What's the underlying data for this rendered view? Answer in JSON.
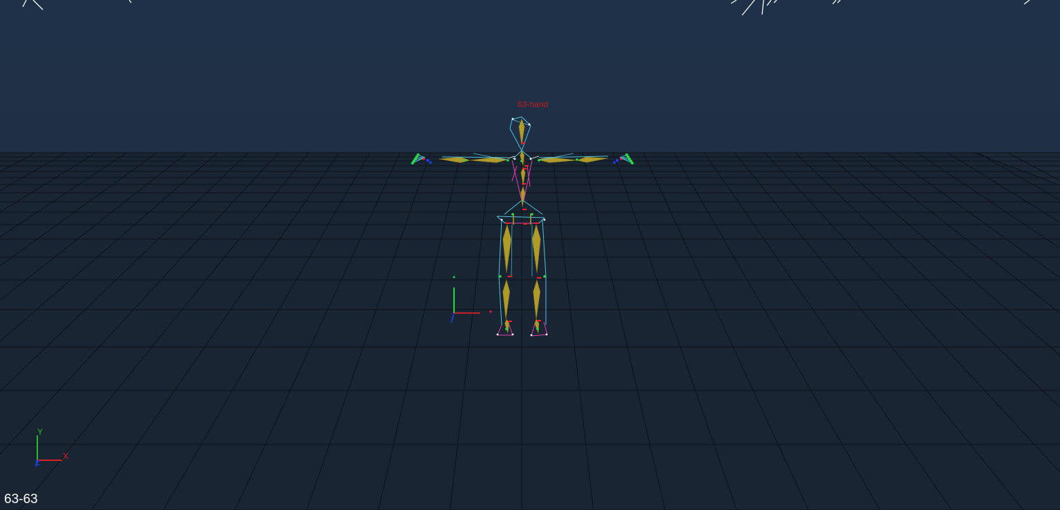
{
  "viewport": {
    "character_label": "63-hand",
    "frame_readout": "63-63"
  },
  "axis_gizmo": {
    "x_label": "X",
    "y_label": "Y",
    "z_label": "Z",
    "x_color": "#e02020",
    "y_color": "#20c020",
    "z_color": "#2040ff"
  },
  "colors": {
    "background": "#1f3148",
    "floor": "#1a2533",
    "grid_line": "#0c1218",
    "bone": "#b8a22a",
    "skeleton_cyan": "#4ec3e0",
    "skeleton_magenta": "#e040b0",
    "joint_green": "#20e040",
    "joint_red": "#ff2020",
    "joint_blue": "#2040ff",
    "label": "#c81818"
  }
}
